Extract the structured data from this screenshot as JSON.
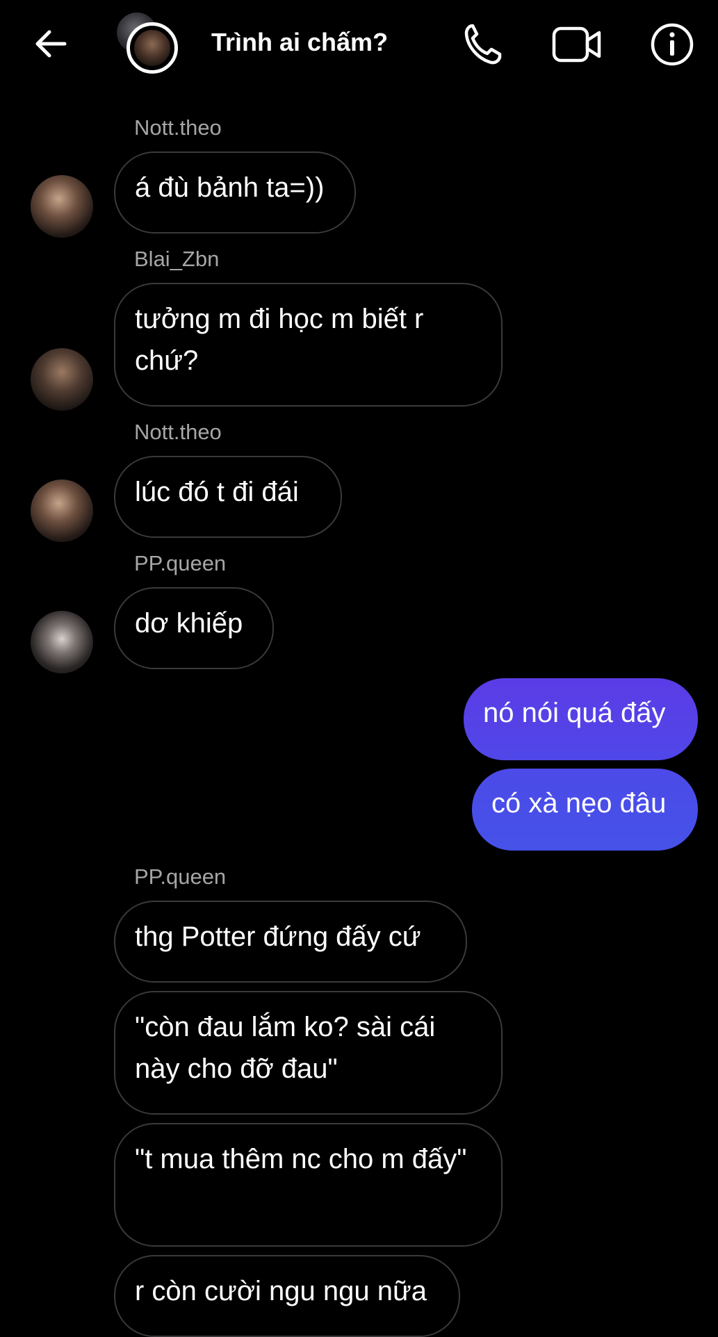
{
  "header": {
    "title": "Trình ai chấm?",
    "back_icon": "arrow-left-icon",
    "call_icon": "phone-icon",
    "video_icon": "video-camera-icon",
    "info_icon": "info-icon"
  },
  "colors": {
    "background": "#000000",
    "incoming_border": "#3a3a3c",
    "sender_name": "#a6a6a6",
    "outgoing_gradient_top": "#5b3ce6",
    "outgoing_gradient_bottom": "#4552e8"
  },
  "messages": [
    {
      "sender": "Nott.theo",
      "text": "á đù bảnh ta=))"
    },
    {
      "sender": "Blai_Zbn",
      "text": "tưởng m đi học m biết r chứ?"
    },
    {
      "sender": "Nott.theo",
      "text": "lúc đó t đi đái"
    },
    {
      "sender": "PP.queen",
      "text": "dơ khiếp"
    },
    {
      "outgoing": true,
      "text": "nó nói quá đấy"
    },
    {
      "outgoing": true,
      "text": "có xà nẹo đâu"
    },
    {
      "sender": "PP.queen",
      "text": "thg Potter đứng đấy cứ"
    },
    {
      "text": "\"còn đau lắm ko? sài cái này cho đỡ đau\""
    },
    {
      "text": "\"t mua thêm nc cho m đấy\""
    },
    {
      "text": "r còn cười ngu ngu nữa"
    }
  ]
}
